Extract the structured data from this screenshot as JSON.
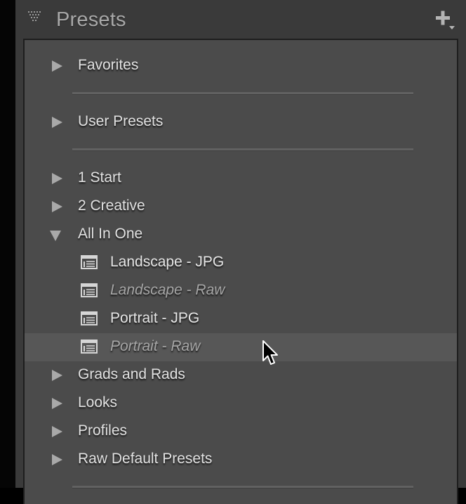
{
  "panel": {
    "title": "Presets",
    "add_icon": "plus-icon",
    "collapse_icon": "collapse-triangle-icon"
  },
  "groups_top": [
    {
      "label": "Favorites",
      "expanded": false
    },
    {
      "label": "User Presets",
      "expanded": false
    }
  ],
  "groups": [
    {
      "label": "1 Start",
      "expanded": false
    },
    {
      "label": "2 Creative",
      "expanded": false
    },
    {
      "label": "All In One",
      "expanded": true
    },
    {
      "label": "Grads and Rads",
      "expanded": false
    },
    {
      "label": "Looks",
      "expanded": false
    },
    {
      "label": "Profiles",
      "expanded": false
    },
    {
      "label": "Raw Default Presets",
      "expanded": false
    }
  ],
  "all_in_one_presets": [
    {
      "label": "Landscape - JPG",
      "style": "normal"
    },
    {
      "label": "Landscape - Raw",
      "style": "italic"
    },
    {
      "label": "Portrait - JPG",
      "style": "normal"
    },
    {
      "label": "Portrait - Raw",
      "style": "italic",
      "highlighted": true
    }
  ],
  "colors": {
    "panel_bg": "#3a3a3a",
    "list_bg": "#4b4b4b",
    "highlight_row": "#575757",
    "text": "#e2e2e2",
    "text_dim": "#a6a6a6"
  }
}
